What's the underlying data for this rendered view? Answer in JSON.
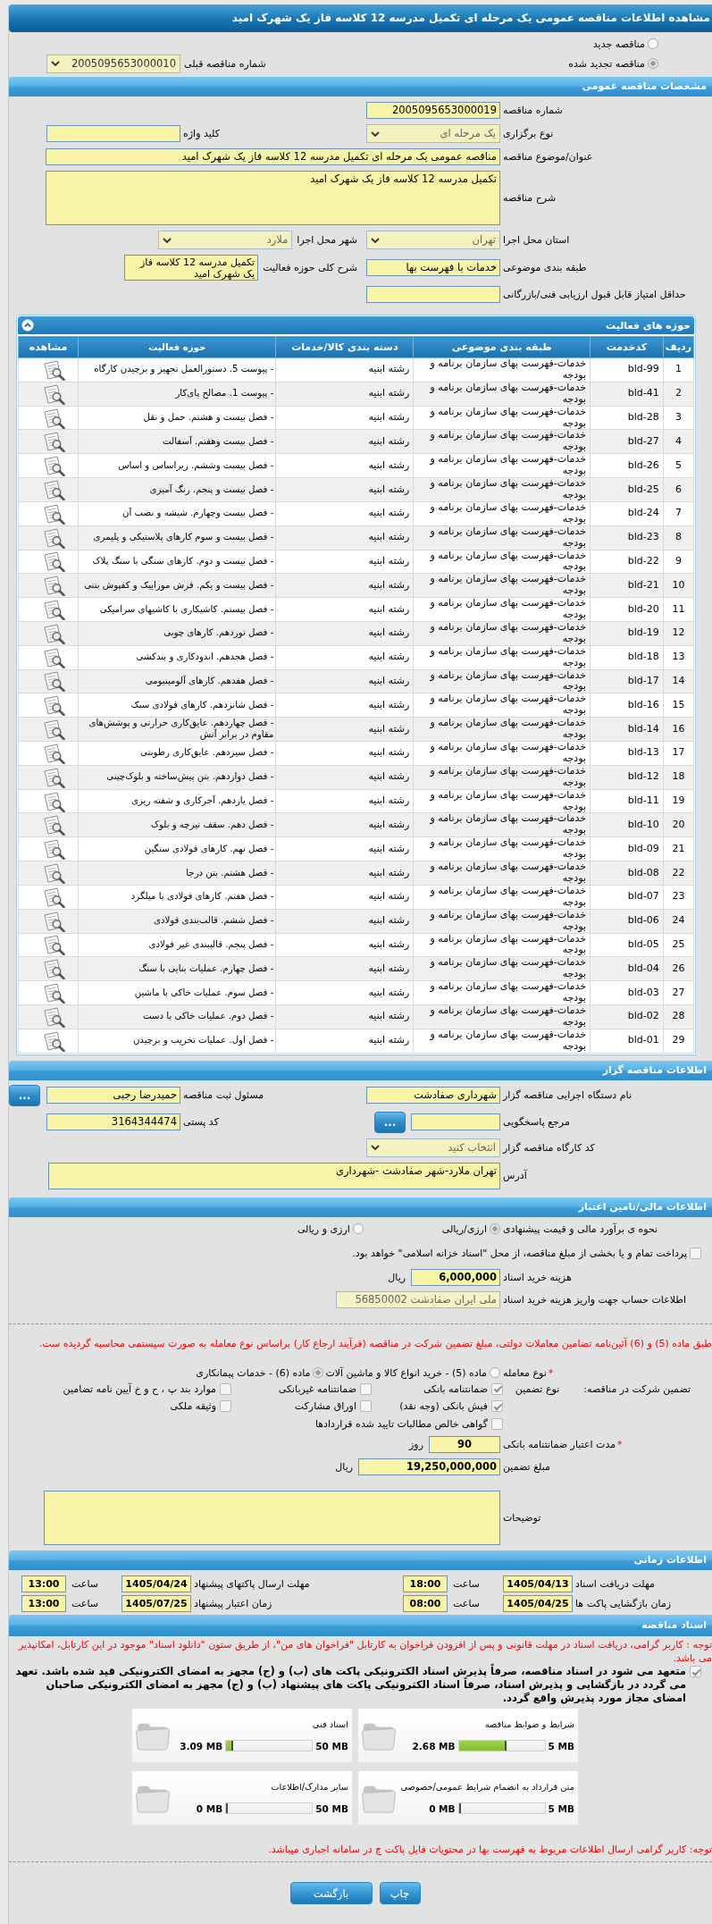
{
  "page_title": "مشاهده اطلاعات مناقصه عمومی یک مرحله ای تکمیل مدرسه 12 کلاسه فاز یک شهرک امید",
  "tender_status": {
    "options": [
      {
        "label": "مناقصه جدید",
        "selected": false
      },
      {
        "label": "مناقصه تجدید شده",
        "selected": true
      }
    ],
    "previous_tender": {
      "label": "شماره مناقصه قبلی",
      "value": "2005095653000010"
    }
  },
  "general": {
    "title": "مشخصات مناقصه عمومی",
    "rows": [
      [
        {
          "label": "شماره مناقصه",
          "kind": "box",
          "value": "2005095653000019"
        }
      ],
      [
        {
          "label": "نوع برگزاری",
          "kind": "select",
          "value": "یک مرحله ای"
        },
        {
          "label": "کلید واژه",
          "kind": "box"
        }
      ],
      [
        {
          "label": "عنوان/موضوع مناقصه",
          "kind": "wide-box",
          "value": "مناقصه عمومی یک مرحله ای تکمیل مدرسه 12 کلاسه فاز یک شهرک امید"
        }
      ],
      [
        {
          "label": "شرح مناقصه",
          "kind": "tall-box",
          "value": "تکمیل مدرسه 12 کلاسه فاز یک شهرک امید"
        }
      ],
      [
        {
          "label": "استان محل اجرا",
          "kind": "select",
          "value": "تهران"
        },
        {
          "label": "شهر محل اجرا",
          "kind": "select",
          "value": "ملارد"
        }
      ],
      [
        {
          "label": "طبقه بندی موضوعی",
          "kind": "box",
          "value": "خدمات با فهرست بها"
        },
        {
          "label": "شرح کلی حوزه فعالیت",
          "kind": "small-box",
          "value": "تکمیل مدرسه 12 کلاسه فاز یک شهرک امید"
        }
      ],
      [
        {
          "label": "حداقل امتیاز قابل قبول ارزیابی فنی/بازرگانی",
          "kind": "box"
        }
      ]
    ]
  },
  "activities": {
    "title": "حوزه های فعالیت",
    "columns": [
      "ردیف",
      "کدخدمت",
      "طبقه بندی موضوعی",
      "دسته بندی کالا/خدمات",
      "حوزه فعالیت",
      "مشاهده"
    ],
    "rows": [
      {
        "number": "1",
        "code": "bld-99",
        "category": "خدمات-فهرست بهای سازمان برنامه و بودجه",
        "group": "رشته ابنیه",
        "activity": "- پیوست 5. دستورالعمل تجهیز و برچیدن کارگاه"
      },
      {
        "number": "2",
        "code": "bld-41",
        "category": "خدمات-فهرست بهای سازمان برنامه و بودجه",
        "group": "رشته ابنیه",
        "activity": "- پیوست 1. مصالح پای‌کار"
      },
      {
        "number": "3",
        "code": "bld-28",
        "category": "خدمات-فهرست بهای سازمان برنامه و بودجه",
        "group": "رشته ابنیه",
        "activity": "- فصل بیست و هشتم. حمل و نقل"
      },
      {
        "number": "4",
        "code": "bld-27",
        "category": "خدمات-فهرست بهای سازمان برنامه و بودجه",
        "group": "رشته ابنیه",
        "activity": "- فصل بیست وهفتم. آسفالت"
      },
      {
        "number": "5",
        "code": "bld-26",
        "category": "خدمات-فهرست بهای سازمان برنامه و بودجه",
        "group": "رشته ابنیه",
        "activity": "- فصل بیست وششم. زیراساس و اساس"
      },
      {
        "number": "6",
        "code": "bld-25",
        "category": "خدمات-فهرست بهای سازمان برنامه و بودجه",
        "group": "رشته ابنیه",
        "activity": "- فصل بیست و پنجم. رنگ آمیزی"
      },
      {
        "number": "7",
        "code": "bld-24",
        "category": "خدمات-فهرست بهای سازمان برنامه و بودجه",
        "group": "رشته ابنیه",
        "activity": "- فصل بیست وچهارم. شیشه و نصب آن"
      },
      {
        "number": "8",
        "code": "bld-23",
        "category": "خدمات-فهرست بهای سازمان برنامه و بودجه",
        "group": "رشته ابنیه",
        "activity": "- فصل بیست و سوم کارهای پلاستیکی و پلیمری"
      },
      {
        "number": "9",
        "code": "bld-22",
        "category": "خدمات-فهرست بهای سازمان برنامه و بودجه",
        "group": "رشته ابنیه",
        "activity": "- فصل بیست و دوم. کارهای سنگی با سنگ پلاک"
      },
      {
        "number": "10",
        "code": "bld-21",
        "category": "خدمات-فهرست بهای سازمان برنامه و بودجه",
        "group": "رشته ابنیه",
        "activity": "- فصل بیست و یکم. فرش موزاییک و کفپوش بتنی"
      },
      {
        "number": "11",
        "code": "bld-20",
        "category": "خدمات-فهرست بهای سازمان برنامه و بودجه",
        "group": "رشته ابنیه",
        "activity": "- فصل بیستم. کاشیکاری با کاشیهای سرامیکی"
      },
      {
        "number": "12",
        "code": "bld-19",
        "category": "خدمات-فهرست بهای سازمان برنامه و بودجه",
        "group": "رشته ابنیه",
        "activity": "- فصل نوزدهم. کارهای چوبی"
      },
      {
        "number": "13",
        "code": "bld-18",
        "category": "خدمات-فهرست بهای سازمان برنامه و بودجه",
        "group": "رشته ابنیه",
        "activity": "- فصل هجدهم. اندودکاری و بندکشی"
      },
      {
        "number": "14",
        "code": "bld-17",
        "category": "خدمات-فهرست بهای سازمان برنامه و بودجه",
        "group": "رشته ابنیه",
        "activity": "- فصل هفدهم. کارهای آلومینیومی"
      },
      {
        "number": "15",
        "code": "bld-16",
        "category": "خدمات-فهرست بهای سازمان برنامه و بودجه",
        "group": "رشته ابنیه",
        "activity": "- فصل شانزدهم. کارهای فولادی سبک"
      },
      {
        "number": "16",
        "code": "bld-14",
        "category": "خدمات-فهرست بهای سازمان برنامه و بودجه",
        "group": "رشته ابنیه",
        "activity": "- فصل چهاردهم. عایق‌کاری حرارتی و پوشش‌های مقاوم در برابر آتش"
      },
      {
        "number": "17",
        "code": "bld-13",
        "category": "خدمات-فهرست بهای سازمان برنامه و بودجه",
        "group": "رشته ابنیه",
        "activity": "- فصل سیزدهم. عایق‌کاری رطوبتی"
      },
      {
        "number": "18",
        "code": "bld-12",
        "category": "خدمات-فهرست بهای سازمان برنامه و بودجه",
        "group": "رشته ابنیه",
        "activity": "- فصل دوازدهم. بتن پیش‌ساخته و بلوک‌چینی"
      },
      {
        "number": "19",
        "code": "bld-11",
        "category": "خدمات-فهرست بهای سازمان برنامه و بودجه",
        "group": "رشته ابنیه",
        "activity": "- فصل یازدهم. آجرکاری و شفته ریزی"
      },
      {
        "number": "20",
        "code": "bld-10",
        "category": "خدمات-فهرست بهای سازمان برنامه و بودجه",
        "group": "رشته ابنیه",
        "activity": "- فصل دهم. سقف تیرچه و بلوک"
      },
      {
        "number": "21",
        "code": "bld-09",
        "category": "خدمات-فهرست بهای سازمان برنامه و بودجه",
        "group": "رشته ابنیه",
        "activity": "- فصل نهم. کارهای فولادی سنگین"
      },
      {
        "number": "22",
        "code": "bld-08",
        "category": "خدمات-فهرست بهای سازمان برنامه و بودجه",
        "group": "رشته ابنیه",
        "activity": "- فصل هشتم. بتن درجا"
      },
      {
        "number": "23",
        "code": "bld-07",
        "category": "خدمات-فهرست بهای سازمان برنامه و بودجه",
        "group": "رشته ابنیه",
        "activity": "- فصل هفتم. کارهای فولادی با میلگرد"
      },
      {
        "number": "24",
        "code": "bld-06",
        "category": "خدمات-فهرست بهای سازمان برنامه و بودجه",
        "group": "رشته ابنیه",
        "activity": "- فصل ششم. قالب‌بندی فولادی"
      },
      {
        "number": "25",
        "code": "bld-05",
        "category": "خدمات-فهرست بهای سازمان برنامه و بودجه",
        "group": "رشته ابنیه",
        "activity": "- فصل پنجم. قالببندی غیر فولادی"
      },
      {
        "number": "26",
        "code": "bld-04",
        "category": "خدمات-فهرست بهای سازمان برنامه و بودجه",
        "group": "رشته ابنیه",
        "activity": "- فصل چهارم. عملیات بنایی با سنگ"
      },
      {
        "number": "27",
        "code": "bld-03",
        "category": "خدمات-فهرست بهای سازمان برنامه و بودجه",
        "group": "رشته ابنیه",
        "activity": "- فصل سوم. عملیات خاکی با ماشین"
      },
      {
        "number": "28",
        "code": "bld-02",
        "category": "خدمات-فهرست بهای سازمان برنامه و بودجه",
        "group": "رشته ابنیه",
        "activity": "- فصل دوم. عملیات خاکی با دست"
      },
      {
        "number": "29",
        "code": "bld-01",
        "category": "خدمات-فهرست بهای سازمان برنامه و بودجه",
        "group": "رشته ابنیه",
        "activity": "- فصل اول. عملیات تخریب و برچیدن"
      }
    ]
  },
  "organizer": {
    "title": "اطلاعات مناقصه گزار",
    "rows": [
      [
        {
          "label": "نام دستگاه اجرایی مناقصه گزار",
          "kind": "box",
          "value": "شهرداری صفادشت"
        },
        {
          "label": "مسئول ثبت مناقصه",
          "kind": "box",
          "value": "حمیدرضا رجبی",
          "button": "..."
        }
      ],
      [
        {
          "label": "مرجع پاسخگویی",
          "kind": "box",
          "button": "..."
        },
        {
          "label": "کد پستی",
          "kind": "box",
          "value": "3164344474"
        }
      ],
      [
        {
          "label": "کد کارگاه مناقصه گزار",
          "kind": "select",
          "value": "انتخاب کنید"
        }
      ],
      [
        {
          "label": "آدرس",
          "kind": "mid-box",
          "value": "تهران ملارد-شهر صفادشت -شهرداری"
        }
      ]
    ]
  },
  "finance": {
    "title": "اطلاعات مالی/تامین اعتبار",
    "estimate": {
      "label": "نحوه ی برآورد مالی و قیمت پیشنهادی",
      "options": [
        {
          "label": "ارزی/ریالی",
          "selected": true
        },
        {
          "label": "ارزی و ریالی",
          "selected": false
        }
      ]
    },
    "treasury": {
      "label": "پرداخت تمام و یا بخشی از مبلغ مناقصه، از محل \"اسناد خزانه اسلامی\" خواهد بود.",
      "checked": false
    },
    "fee": {
      "label": "هزینه خرید اسناد",
      "value": "6,000,000",
      "unit": "ریال"
    },
    "account": {
      "label": "اطلاعات حساب جهت واریز هزینه خرید اسناد",
      "value": "ملی ایران صفادشت 56850002"
    }
  },
  "guarantee": {
    "notice": "طبق ماده (5) و (6) آئین‌نامه تضامین معاملات دولتی، مبلغ تضمین شرکت در مناقصه (فرآیند ارجاع کار) براساس نوع معامله به صورت سیستمی محاسبه گردیده ست.",
    "deal_type": {
      "marker": "*",
      "label": "نوع معامله",
      "options": [
        {
          "label": "ماده (5) - خرید انواع کالا و ماشین آلات",
          "selected": false
        },
        {
          "label": "ماده (6) - خدمات پیمانکاری",
          "selected": true
        }
      ]
    },
    "types": {
      "label": "تضمین شرکت در مناقصه:",
      "type_label": "نوع تضمین",
      "options": [
        {
          "label": "ضمانتنامه بانکی",
          "checked": true
        },
        {
          "label": "ضمانتنامه غیربانکی",
          "checked": false
        },
        {
          "label": "موارد بند پ ، ح و خ آیین نامه تضامین",
          "checked": false
        },
        {
          "label": "فیش بانکی (وجه نقد)",
          "checked": true
        },
        {
          "label": "اوراق مشارکت",
          "checked": false
        },
        {
          "label": "وثیقه ملکی",
          "checked": false
        },
        {
          "label": "گواهی خالص مطالبات تایید شده قراردادها",
          "checked": false
        }
      ]
    },
    "validity": {
      "marker": "*",
      "label": "مدت اعتبار ضمانتنامه بانکی",
      "value": "90",
      "unit": "روز"
    },
    "amount": {
      "label": "مبلغ تضمین",
      "value": "19,250,000,000",
      "unit": "ریال"
    },
    "notes": {
      "label": "توضیحات"
    }
  },
  "schedule": {
    "title": "اطلاعات زمانی",
    "rows": [
      [
        {
          "label": "مهلت دریافت اسناد",
          "date": "1405/04/13",
          "time_label": "ساعت",
          "time": "18:00"
        },
        {
          "label": "مهلت ارسال پاکتهای پیشنهاد",
          "date": "1405/04/24",
          "time_label": "ساعت",
          "time": "13:00"
        }
      ],
      [
        {
          "label": "زمان بازگشایی پاکت ها",
          "date": "1405/04/25",
          "time_label": "ساعت",
          "time": "08:00"
        },
        {
          "label": "زمان اعتبار پیشنهاد",
          "date": "1405/07/25",
          "time_label": "ساعت",
          "time": "13:00"
        }
      ]
    ]
  },
  "documents": {
    "title": "اسناد مناقصه",
    "notice": "توجه : کاربر گرامی، دریافت اسناد در مهلت قانونی و پس از افزودن فراخوان به کارتابل \"فراخوان های من\"، از طریق ستون \"دانلود اسناد\" موجود در این کارتابل، امکانپذیر می باشد.",
    "pledge": {
      "text": "متعهد می شود در اسناد مناقصه، صرفاً پذیرش اسناد الکترونیکی پاکت های (ب) و (ج) مجهز به امضای الکترونیکی قید شده باشد. تعهد می گردد در بازگشایی و پذیرش اسناد، صرفاً اسناد الکترونیکی پاکت های پیشنهاد (ب) و (ج) مجهز به امضای الکترونیکی صاحبان امضای مجاز مورد پذیرش واقع گردد.",
      "checked": true
    },
    "files": [
      {
        "name": "شرایط و ضوابط مناقصه",
        "size": "2.68 MB",
        "limit": "5 MB",
        "level": 0.536
      },
      {
        "name": "اسناد فنی",
        "size": "3.09 MB",
        "limit": "50 MB",
        "level": 0.062
      },
      {
        "name": "متن قرارداد به انضمام شرایط عمومی/خصوصی",
        "size": "0 MB",
        "limit": "5 MB",
        "level": 0
      },
      {
        "name": "سایر مدارک/اطلاعات",
        "size": "0 MB",
        "limit": "50 MB",
        "level": 0
      }
    ],
    "note": "توجه: کاربر گرامی ارسال اطلاعات مربوط به فهرست بها در محتویات فایل پاکت ج در سامانه اجباری میباشد."
  },
  "buttons": [
    "چاپ",
    "بازگشت"
  ]
}
